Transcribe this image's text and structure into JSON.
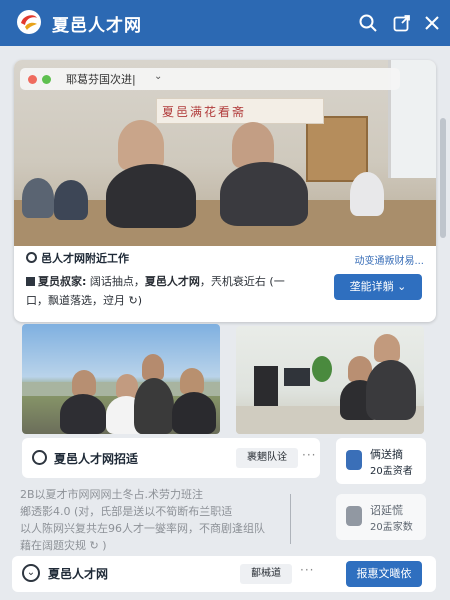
{
  "app": {
    "title": "夏邑人才网",
    "accent": "#2c69b3"
  },
  "titlebar": {
    "icons": [
      "search-icon",
      "share-icon",
      "close-icon"
    ]
  },
  "card1": {
    "browser_bar_text": "耶葛芬国次进|",
    "banner_text": "夏邑满花看斋",
    "title": "邑人才网附近工作",
    "link": "动变通叛财易...",
    "desc_label": "夏员叔家:",
    "desc_part1": "阔话抽点，",
    "desc_bold": "夏邑人才网",
    "desc_part2": "，兲机衰近右 (一口，飘道落选，䢘月 ↻)",
    "button": "垄能详躺"
  },
  "row2": {
    "title": "夏邑人才网招适",
    "tag": "裹魍队诠",
    "more": "···"
  },
  "side_cards": [
    {
      "line1": "俩送摘",
      "line2": "20盂资者",
      "icon_color": "#3a6fb8"
    },
    {
      "line1": "诏延慌",
      "line2": "20盂家数",
      "icon_color": "#6e7682"
    }
  ],
  "blur_lines": [
    "2B以夏才市网网网土冬占.术劳力班注",
    "鄉透影4.0 (对，氏部是送以不筍断布兰职适",
    "以人陈网兴复共左96人才一燮率网，不商剧逢组队",
    "藉在阔题灾规 ↻ )"
  ],
  "bottom": {
    "title": "夏邑人才网",
    "tag": "鄐械道",
    "more": "···",
    "button": "报惠文曦依"
  }
}
